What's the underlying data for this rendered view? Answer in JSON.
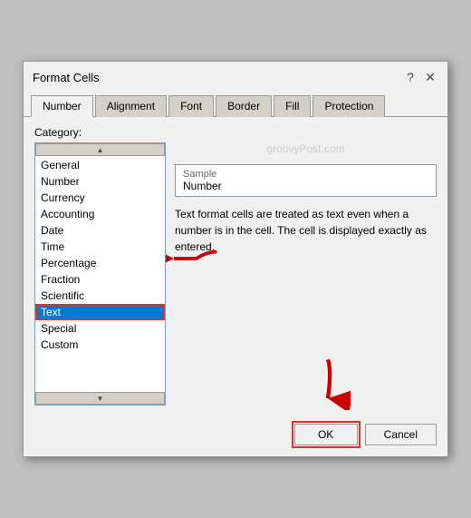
{
  "dialog": {
    "title": "Format Cells",
    "help_icon": "?",
    "close_icon": "✕"
  },
  "tabs": [
    {
      "label": "Number",
      "active": true
    },
    {
      "label": "Alignment",
      "active": false
    },
    {
      "label": "Font",
      "active": false
    },
    {
      "label": "Border",
      "active": false
    },
    {
      "label": "Fill",
      "active": false
    },
    {
      "label": "Protection",
      "active": false
    }
  ],
  "category": {
    "label": "Category:",
    "items": [
      {
        "label": "General"
      },
      {
        "label": "Number"
      },
      {
        "label": "Currency"
      },
      {
        "label": "Accounting"
      },
      {
        "label": "Date"
      },
      {
        "label": "Time"
      },
      {
        "label": "Percentage"
      },
      {
        "label": "Fraction"
      },
      {
        "label": "Scientific"
      },
      {
        "label": "Text",
        "selected": true
      },
      {
        "label": "Special"
      },
      {
        "label": "Custom"
      }
    ]
  },
  "right_panel": {
    "watermark": "groovyPost.com",
    "sample_label": "Sample",
    "sample_value": "Number",
    "description": "Text format cells are treated as text even when a number is in the cell. The cell is displayed exactly as entered."
  },
  "buttons": {
    "ok_label": "OK",
    "cancel_label": "Cancel"
  }
}
